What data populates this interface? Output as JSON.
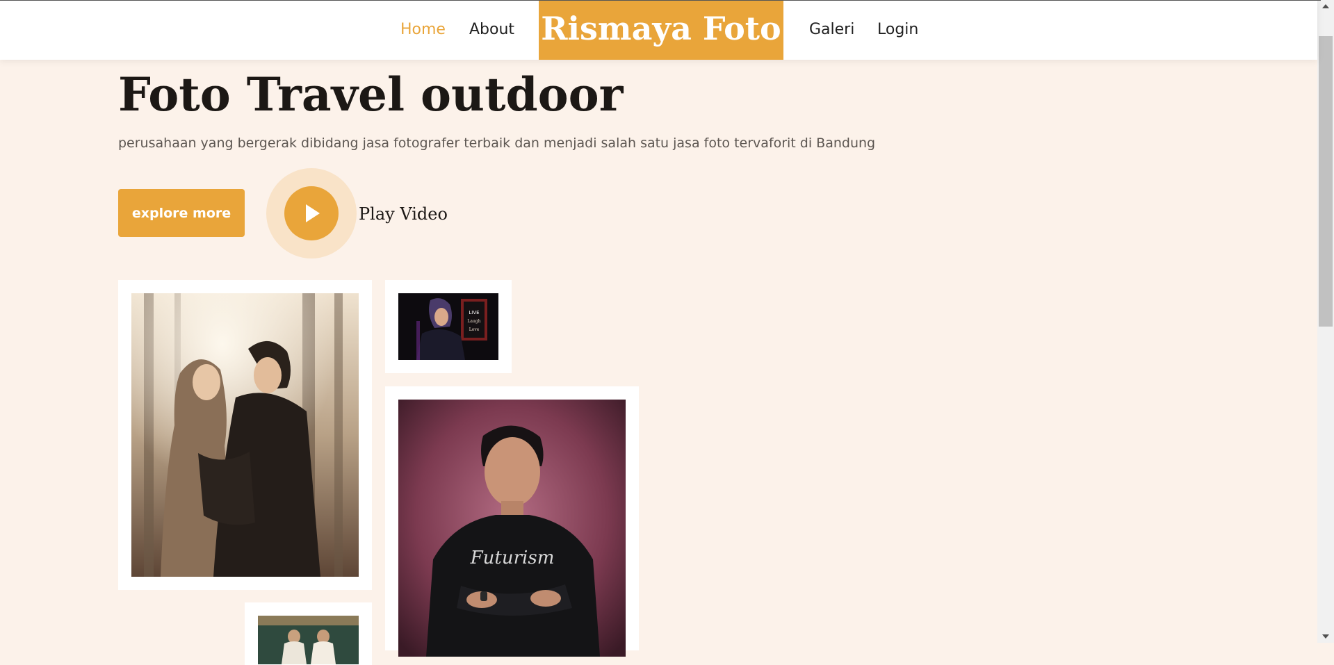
{
  "nav": {
    "home": "Home",
    "about": "About",
    "brand": "Rismaya Foto",
    "galeri": "Galeri",
    "login": "Login",
    "active": "Home"
  },
  "hero": {
    "title": "Foto Travel outdoor",
    "subtitle": "perusahaan yang bergerak dibidang jasa fotografer terbaik dan menjadi salah satu jasa foto tervaforit di Bandung",
    "explore_label": "explore more",
    "play_label": "Play Video",
    "play_icon": "play-icon"
  },
  "gallery": {
    "photos": [
      {
        "name": "couple-photo"
      },
      {
        "name": "woman-hijab-photo"
      },
      {
        "name": "man-portrait-photo"
      },
      {
        "name": "wedding-photo"
      }
    ]
  },
  "colors": {
    "accent": "#e9a53a",
    "background": "#fcf2ea",
    "text_dark": "#1c1815",
    "text_muted": "#5c5651"
  }
}
